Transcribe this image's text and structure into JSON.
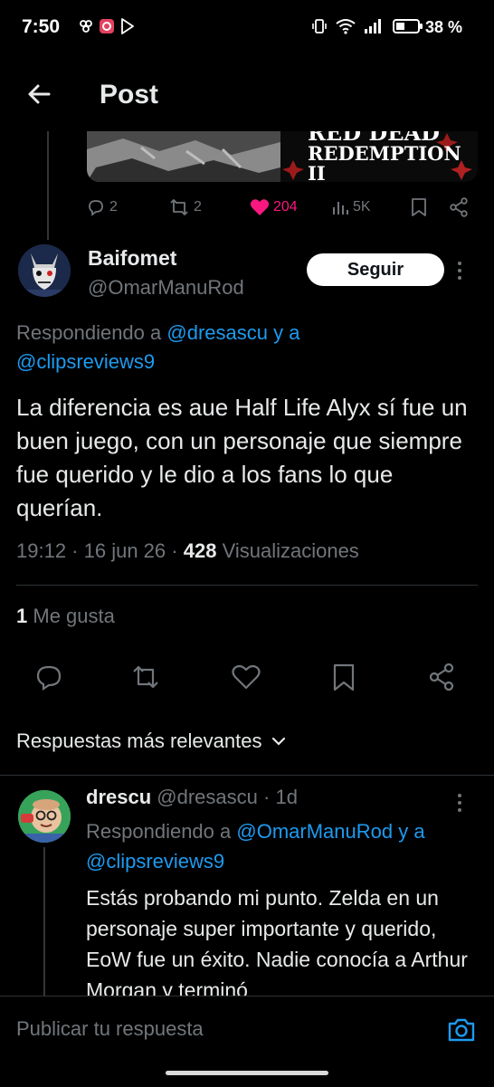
{
  "status_bar": {
    "time": "7:50",
    "battery": "38 %",
    "icons": [
      "app-notification-icon",
      "app-notification-icon",
      "play-store-icon",
      "vibrate-icon",
      "wifi-icon",
      "signal-icon",
      "battery-icon"
    ]
  },
  "header": {
    "title": "Post",
    "back_icon": "arrow-left-icon"
  },
  "parent_tweet": {
    "media_right_title_line1": "RED DEAD",
    "media_right_title_line2": "REDEMPTION II",
    "actions": {
      "replies": "2",
      "reposts": "2",
      "likes": "204",
      "views": "5K"
    },
    "like_color": "#f91880"
  },
  "tweet": {
    "author_name": "Baifomet",
    "author_handle": "@OmarManuRod",
    "follow_label": "Seguir",
    "replying_prefix": "Respondiendo a",
    "replying_user1": "@dresascu",
    "replying_and": "y a",
    "replying_user2": "@clipsreviews9",
    "text": "La diferencia es aue Half Life Alyx sí fue un buen juego, con un personaje que siempre fue querido  y le dio a los fans lo que querían.",
    "time": "19:12",
    "date": "16 jun 26",
    "views_count": "428",
    "views_label": "Visualizaciones",
    "likes_count": "1",
    "likes_label": "Me gusta"
  },
  "replies_sort": {
    "label": "Respuestas más relevantes"
  },
  "reply": {
    "author_name": "drescu",
    "author_handle": "@dresascu",
    "age": "1d",
    "replying_prefix": "Respondiendo a",
    "replying_user1": "@OmarManuRod",
    "replying_and": "y a",
    "replying_user2": "@clipsreviews9",
    "text": "Estás probando mi punto. Zelda en un personaje super importante y querido, EoW fue un éxito. Nadie conocía a Arthur Morgan y terminó"
  },
  "compose": {
    "placeholder": "Publicar tu respuesta"
  },
  "colors": {
    "accent": "#1d9bf0",
    "muted": "#71767b",
    "background": "#000000"
  }
}
